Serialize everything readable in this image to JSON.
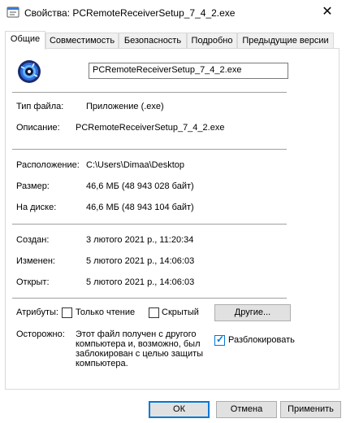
{
  "window": {
    "title": "Свойства: PCRemoteReceiverSetup_7_4_2.exe",
    "close_glyph": "✕"
  },
  "tabs": [
    "Общие",
    "Совместимость",
    "Безопасность",
    "Подробно",
    "Предыдущие версии"
  ],
  "general": {
    "file_name": "PCRemoteReceiverSetup_7_4_2.exe",
    "type_label": "Тип файла:",
    "type_value": "Приложение (.exe)",
    "desc_label": "Описание:",
    "desc_value": "PCRemoteReceiverSetup_7_4_2.exe",
    "location_label": "Расположение:",
    "location_value": "C:\\Users\\Dimaa\\Desktop",
    "size_label": "Размер:",
    "size_value": "46,6 МБ (48 943 028 байт)",
    "disk_label": "На диске:",
    "disk_value": "46,6 МБ (48 943 104 байт)",
    "created_label": "Создан:",
    "created_value": "3 лютого 2021 р., 11:20:34",
    "modified_label": "Изменен:",
    "modified_value": "5 лютого 2021 р., 14:06:03",
    "opened_label": "Открыт:",
    "opened_value": "5 лютого 2021 р., 14:06:03",
    "attributes_label": "Атрибуты:",
    "readonly_label": "Только чтение",
    "readonly_checked": false,
    "hidden_label": "Скрытый",
    "hidden_checked": false,
    "other_button": "Другие...",
    "caution_label": "Осторожно:",
    "caution_text": "Этот файл получен с другого компьютера и, возможно, был заблокирован с целью защиты компьютера.",
    "unblock_label": "Разблокировать",
    "unblock_checked": true
  },
  "buttons": {
    "ok": "ОК",
    "cancel": "Отмена",
    "apply": "Применить"
  },
  "colors": {
    "accent": "#0078d7",
    "separator": "#a0a0a0"
  }
}
